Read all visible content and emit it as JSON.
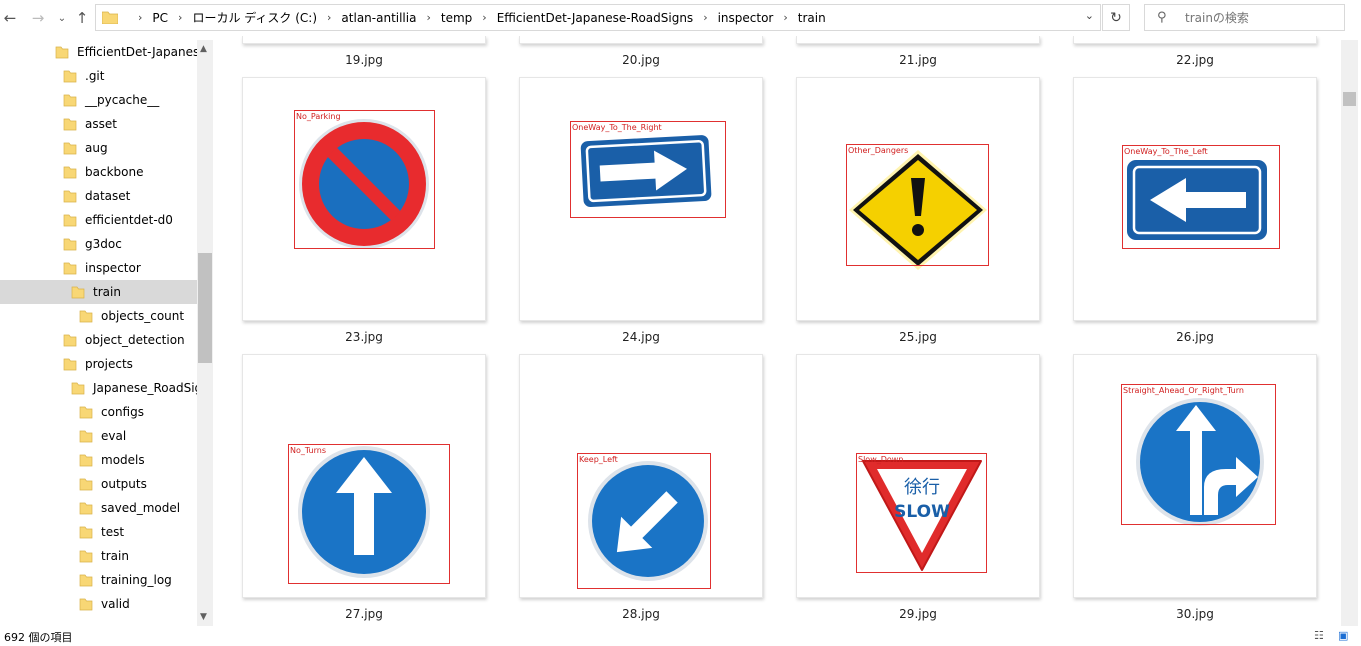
{
  "nav": {
    "back_icon": "arrow-left-icon",
    "forward_icon": "arrow-right-icon",
    "recent_icon": "chevron-down-icon",
    "up_icon": "arrow-up-icon"
  },
  "address": {
    "crumbs": [
      "PC",
      "ローカル ディスク (C:)",
      "atlan-antillia",
      "temp",
      "EfficientDet-Japanese-RoadSigns",
      "inspector",
      "train"
    ]
  },
  "search": {
    "placeholder": "trainの検索"
  },
  "sidebar": {
    "items": [
      {
        "label": "EfficientDet-Japanese-R"
      },
      {
        "label": ".git"
      },
      {
        "label": "__pycache__"
      },
      {
        "label": "asset"
      },
      {
        "label": "aug"
      },
      {
        "label": "backbone"
      },
      {
        "label": "dataset"
      },
      {
        "label": "efficientdet-d0"
      },
      {
        "label": "g3doc"
      },
      {
        "label": "inspector"
      },
      {
        "label": "train"
      },
      {
        "label": "objects_count"
      },
      {
        "label": "object_detection"
      },
      {
        "label": "projects"
      },
      {
        "label": "Japanese_RoadSigns"
      },
      {
        "label": "configs"
      },
      {
        "label": "eval"
      },
      {
        "label": "models"
      },
      {
        "label": "outputs"
      },
      {
        "label": "saved_model"
      },
      {
        "label": "test"
      },
      {
        "label": "train"
      },
      {
        "label": "training_log"
      },
      {
        "label": "valid"
      }
    ]
  },
  "files": {
    "top_row": [
      "19.jpg",
      "20.jpg",
      "21.jpg",
      "22.jpg"
    ],
    "row1": [
      {
        "name": "23.jpg",
        "label": "No_Parking"
      },
      {
        "name": "24.jpg",
        "label": "OneWay_To_The_Right"
      },
      {
        "name": "25.jpg",
        "label": "Other_Dangers"
      },
      {
        "name": "26.jpg",
        "label": "OneWay_To_The_Left"
      }
    ],
    "row2": [
      {
        "name": "27.jpg",
        "label": "No_Turns"
      },
      {
        "name": "28.jpg",
        "label": "Keep_Left"
      },
      {
        "name": "29.jpg",
        "label": "Slow_Down"
      },
      {
        "name": "30.jpg",
        "label": "Straight_Ahead_Or_Right_Turn"
      }
    ]
  },
  "sign_text": {
    "kanji": "徐行",
    "slow": "SLOW"
  },
  "status": {
    "count": "692 個の項目"
  },
  "colors": {
    "bbox": "#e03030",
    "sign_blue": "#1a6fbf",
    "sign_red": "#e02b2b",
    "warning_yellow": "#f5d000",
    "folder": "#f8d775",
    "selection": "#cce8ff"
  }
}
